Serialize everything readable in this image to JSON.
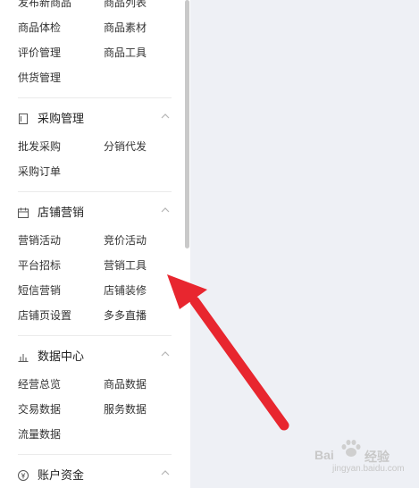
{
  "sidebar": {
    "section_top_items": [
      "发布新商品",
      "商品列表",
      "商品体检",
      "商品素材",
      "评价管理",
      "商品工具",
      "供货管理"
    ],
    "purchase": {
      "title": "采购管理",
      "items": [
        "批发采购",
        "分销代发",
        "采购订单"
      ]
    },
    "marketing": {
      "title": "店铺营销",
      "items": [
        "营销活动",
        "竞价活动",
        "平台招标",
        "营销工具",
        "短信营销",
        "店铺装修",
        "店铺页设置",
        "多多直播"
      ]
    },
    "data_center": {
      "title": "数据中心",
      "items": [
        "经营总览",
        "商品数据",
        "交易数据",
        "服务数据",
        "流量数据"
      ]
    },
    "account": {
      "title": "账户资金"
    }
  },
  "icons": {
    "purchase": "document-icon",
    "marketing": "calendar-icon",
    "data_center": "bar-chart-icon",
    "account": "yen-icon",
    "collapse": "chevron-up-icon"
  },
  "annotation": {
    "arrow_color": "#e8262f"
  },
  "watermark": {
    "brand": "Bai",
    "brand2": "经验",
    "sub": "jingyan.baidu.com"
  }
}
